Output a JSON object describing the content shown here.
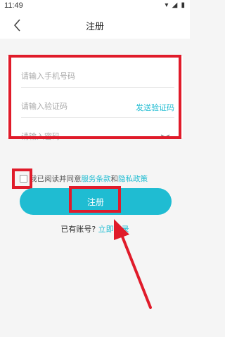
{
  "status_bar": {
    "time": "11:49",
    "icons": [
      "wifi-icon",
      "signal-icon",
      "battery-icon"
    ]
  },
  "header": {
    "title": "注册",
    "back_icon": "chevron-left-icon"
  },
  "form": {
    "phone_placeholder": "请输入手机号码",
    "code_placeholder": "请输入验证码",
    "send_code_label": "发送验证码",
    "password_placeholder": "请输入密码",
    "password_toggle_icon": "eye-closed-icon"
  },
  "agreement": {
    "prefix": "我已阅读并同意",
    "terms_link": "服务条款",
    "conjunction": "和",
    "privacy_link": "隐私政策",
    "checked": false
  },
  "register_label": "注册",
  "login_prompt": {
    "text": "已有账号?",
    "link": "立即登录"
  },
  "colors": {
    "accent": "#1fbcd2",
    "highlight": "#e01b2a",
    "background": "#f5f5f5"
  }
}
